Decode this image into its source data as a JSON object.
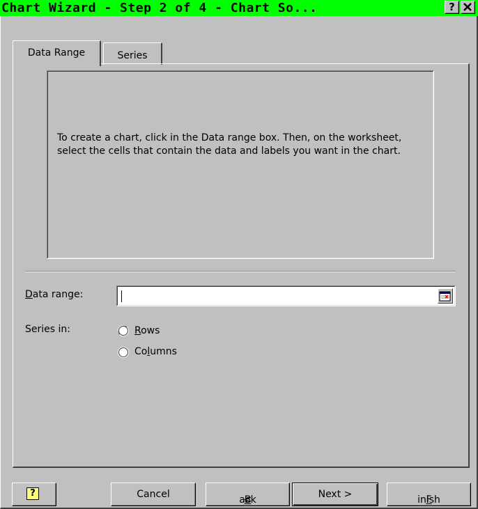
{
  "window": {
    "title": "Chart Wizard - Step 2 of 4 - Chart So...",
    "title_bg_color": "#00ff00",
    "help_button": "?",
    "close_button": "✕"
  },
  "tabs": [
    {
      "label": "Data Range",
      "selected": true
    },
    {
      "label": "Series",
      "selected": false
    }
  ],
  "preview": {
    "message": "To create a chart, click in the Data range box. Then, on the worksheet, select the cells that contain the data and labels you want in the chart."
  },
  "data_range": {
    "label_prefix": "D",
    "label_rest": "ata range:",
    "value": "",
    "collapse_icon": "range-collapse-icon"
  },
  "series_in": {
    "label": "Series in:",
    "options": [
      {
        "label_prefix": "R",
        "label_rest": "ows",
        "selected": false
      },
      {
        "label_prefix": "Co",
        "label_mid": "l",
        "label_rest": "umns",
        "selected": false
      }
    ]
  },
  "buttons": {
    "help_icon": "help-icon",
    "cancel": "Cancel",
    "back_prefix": "< ",
    "back_mnemonic": "B",
    "back_rest": "ack",
    "next": "Next >",
    "finish_mnemonic": "F",
    "finish_rest": "inish"
  }
}
